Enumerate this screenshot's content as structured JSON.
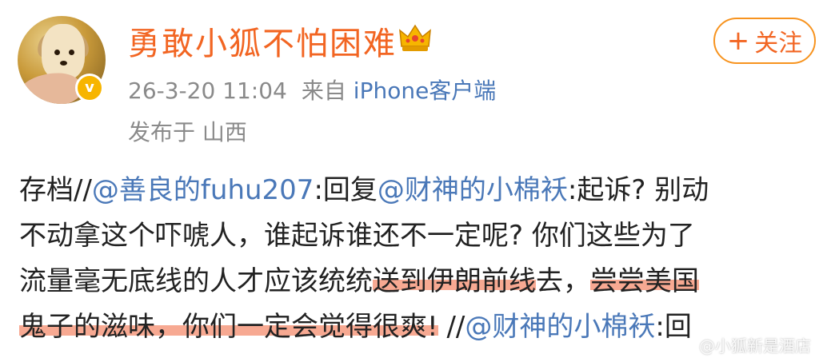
{
  "author": {
    "username": "勇敢小狐不怕困难",
    "verified_mark": "v"
  },
  "follow_button": {
    "plus": "+",
    "label": "关注"
  },
  "meta": {
    "timestamp": "26-3-20 11:04",
    "source_prefix": "来自",
    "source_client": "iPhone客户端",
    "location": "发布于 山西"
  },
  "post": {
    "line1": {
      "a": "存档//",
      "m1": "@善良的fuhu207",
      "b": ":回复",
      "m2": "@财神的小棉袄",
      "c": ":起诉? 别动"
    },
    "line2": {
      "a": "不动拿这个吓唬人，谁起诉谁还不一定呢? 你们这些为了"
    },
    "line3": {
      "a": "流量毫无底线的人才应该统统",
      "hl1": "送到伊朗前线",
      "b": "去，",
      "hl2": "尝尝美国"
    },
    "line4": {
      "hl": "鬼子的滋味，你们一定会觉得很爽!",
      "b": " //",
      "m": "@财神的小棉袄",
      "c": ":回"
    }
  },
  "watermark": "@小狐新是酒店"
}
